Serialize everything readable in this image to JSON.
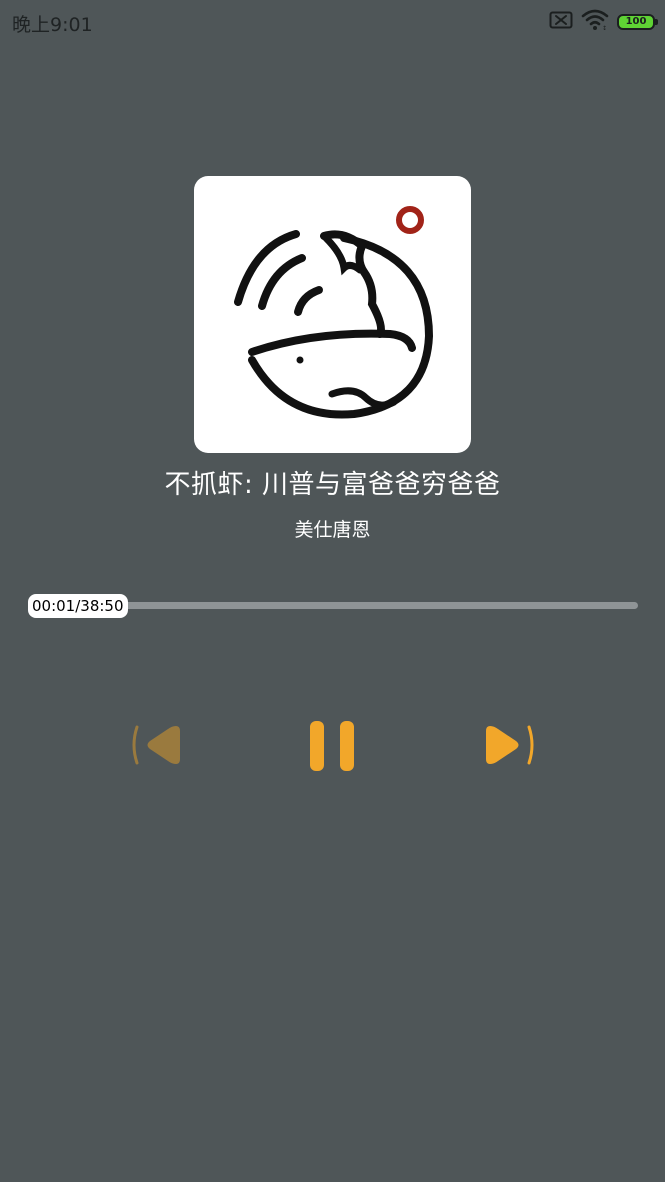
{
  "status_bar": {
    "time": "晚上9:01",
    "battery_level": "100",
    "icons": [
      "sim-off-icon",
      "wifi-icon",
      "battery-icon"
    ]
  },
  "player": {
    "title": "不抓虾: 川普与富爸爸穷爸爸",
    "artist": "美仕唐恩",
    "time_display": "00:01/38:50",
    "progress_fraction": 0.0004,
    "state": "playing"
  },
  "controls": {
    "icons": [
      "previous-icon",
      "pause-icon",
      "next-icon"
    ]
  },
  "colors": {
    "background": "#4f5658",
    "accent": "#f2a72a",
    "accent_dim": "#9a7a3e",
    "progress_track": "#8f9496",
    "cover_logo_dot": "#a12318"
  }
}
